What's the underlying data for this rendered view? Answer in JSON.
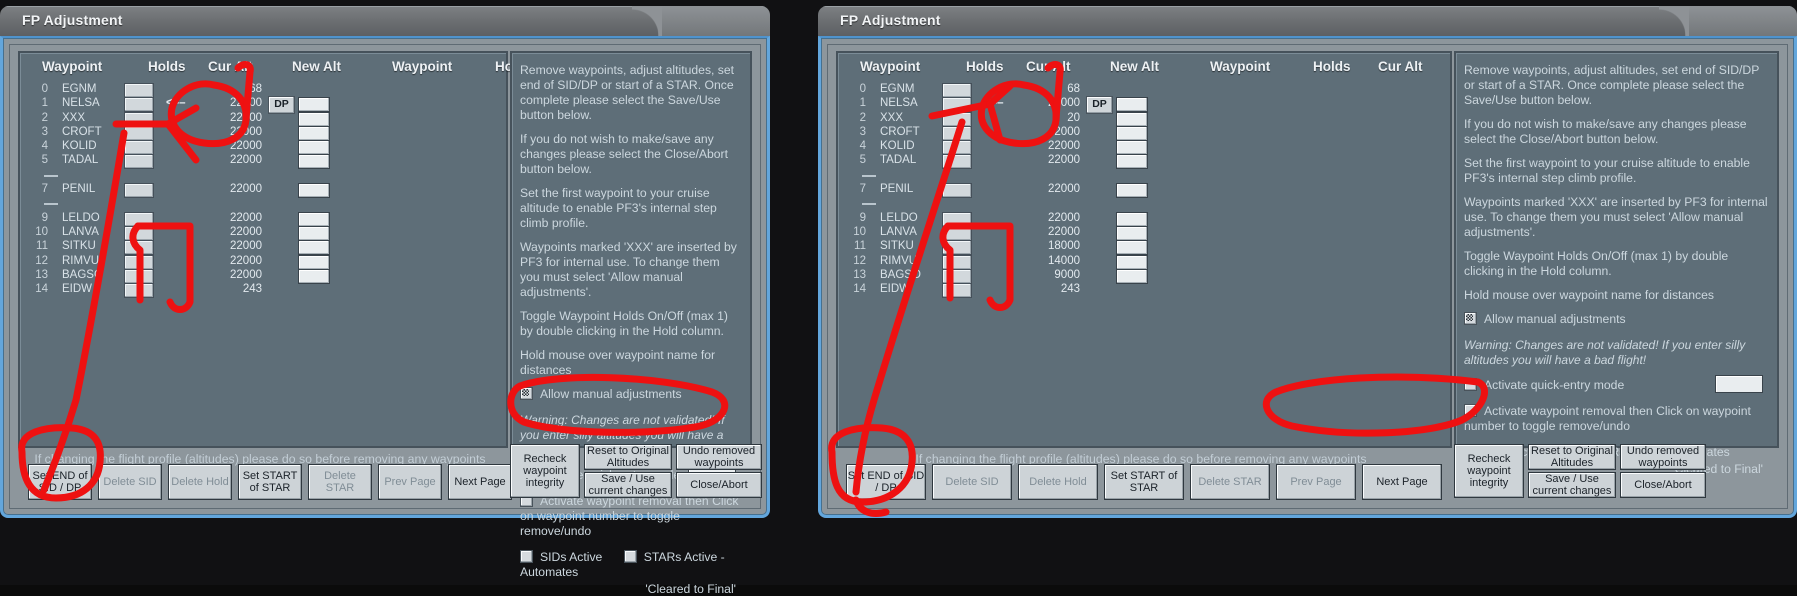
{
  "window": {
    "title": "FP Adjustment"
  },
  "table": {
    "headers": [
      "Waypoint",
      "Holds",
      "Cur Alt",
      "New Alt"
    ],
    "dp_button": "DP",
    "arrow_marker": "<––"
  },
  "left_panel": {
    "rows": [
      {
        "idx": "0",
        "name": "EGNM",
        "alt": "68",
        "sep": false,
        "hold": true,
        "newalt": false
      },
      {
        "idx": "1",
        "name": "NELSA",
        "alt": "22000",
        "sep": false,
        "hold": true,
        "newalt": true,
        "arrow": true,
        "dp": true
      },
      {
        "idx": "2",
        "name": "XXX",
        "alt": "22000",
        "sep": false,
        "hold": true,
        "newalt": true
      },
      {
        "idx": "3",
        "name": "CROFT",
        "alt": "22000",
        "sep": false,
        "hold": true,
        "newalt": true
      },
      {
        "idx": "4",
        "name": "KOLID",
        "alt": "22000",
        "sep": false,
        "hold": true,
        "newalt": true
      },
      {
        "idx": "5",
        "name": "TADAL",
        "alt": "22000",
        "sep": false,
        "hold": true,
        "newalt": true
      },
      {
        "idx": "6",
        "name": "",
        "alt": "",
        "sep": true,
        "hold": false,
        "newalt": false
      },
      {
        "idx": "7",
        "name": "PENIL",
        "alt": "22000",
        "sep": false,
        "hold": true,
        "newalt": true
      },
      {
        "idx": "8",
        "name": "",
        "alt": "",
        "sep": true,
        "hold": false,
        "newalt": false
      },
      {
        "idx": "9",
        "name": "LELDO",
        "alt": "22000",
        "sep": false,
        "hold": true,
        "newalt": true
      },
      {
        "idx": "10",
        "name": "LANVA",
        "alt": "22000",
        "sep": false,
        "hold": true,
        "newalt": true
      },
      {
        "idx": "11",
        "name": "SITKU",
        "alt": "22000",
        "sep": false,
        "hold": true,
        "newalt": true
      },
      {
        "idx": "12",
        "name": "RIMVU",
        "alt": "22000",
        "sep": false,
        "hold": true,
        "newalt": true
      },
      {
        "idx": "13",
        "name": "BAGSO",
        "alt": "22000",
        "sep": false,
        "hold": true,
        "newalt": true
      },
      {
        "idx": "14",
        "name": "EIDW",
        "alt": "243",
        "sep": false,
        "hold": true,
        "newalt": false
      }
    ]
  },
  "right_panel": {
    "rows": [
      {
        "idx": "0",
        "name": "EGNM",
        "alt": "68",
        "sep": false,
        "hold": true,
        "newalt": false
      },
      {
        "idx": "1",
        "name": "NELSA",
        "alt": "22000",
        "sep": false,
        "hold": true,
        "newalt": true,
        "arrow": true,
        "dp": true
      },
      {
        "idx": "2",
        "name": "XXX",
        "alt": "20",
        "sep": false,
        "hold": true,
        "newalt": true
      },
      {
        "idx": "3",
        "name": "CROFT",
        "alt": "2000",
        "sep": false,
        "hold": true,
        "newalt": true
      },
      {
        "idx": "4",
        "name": "KOLID",
        "alt": "22000",
        "sep": false,
        "hold": true,
        "newalt": true
      },
      {
        "idx": "5",
        "name": "TADAL",
        "alt": "22000",
        "sep": false,
        "hold": true,
        "newalt": true
      },
      {
        "idx": "6",
        "name": "",
        "alt": "",
        "sep": true,
        "hold": false,
        "newalt": false
      },
      {
        "idx": "7",
        "name": "PENIL",
        "alt": "22000",
        "sep": false,
        "hold": true,
        "newalt": true
      },
      {
        "idx": "8",
        "name": "",
        "alt": "",
        "sep": true,
        "hold": false,
        "newalt": false
      },
      {
        "idx": "9",
        "name": "LELDO",
        "alt": "22000",
        "sep": false,
        "hold": true,
        "newalt": true
      },
      {
        "idx": "10",
        "name": "LANVA",
        "alt": "22000",
        "sep": false,
        "hold": true,
        "newalt": true
      },
      {
        "idx": "11",
        "name": "SITKU",
        "alt": "18000",
        "sep": false,
        "hold": true,
        "newalt": true
      },
      {
        "idx": "12",
        "name": "RIMVU",
        "alt": "14000",
        "sep": false,
        "hold": true,
        "newalt": true
      },
      {
        "idx": "13",
        "name": "BAGSO",
        "alt": "9000",
        "sep": false,
        "hold": true,
        "newalt": true
      },
      {
        "idx": "14",
        "name": "EIDW",
        "alt": "243",
        "sep": false,
        "hold": true,
        "newalt": false
      }
    ]
  },
  "info": {
    "para1": "Remove waypoints, adjust altitudes, set end of SID/DP or start of a STAR. Once complete please select the Save/Use button below.",
    "para2": "If you do not wish to make/save any changes please select the Close/Abort button below.",
    "para3": "Set the first waypoint to your cruise altitude to enable PF3's internal step climb profile.",
    "para4": "Waypoints marked 'XXX' are inserted by PF3 for internal use. To change them you must select 'Allow manual adjustments'.",
    "para5": "Toggle Waypoint Holds On/Off (max 1) by double clicking in the Hold column.",
    "para6": "Hold mouse over waypoint name for distances",
    "cb_allow_manual": "Allow manual adjustments",
    "warning": "Warning: Changes are not validated! If you enter silly altitudes you will have a bad flight!",
    "cb_quick_entry": "Activate quick-entry mode",
    "cb_waypoint_removal": "Activate waypoint removal then Click on waypoint number to toggle remove/undo",
    "cb_sids_active": "SIDs Active",
    "cb_stars_active": "STARs Active - Automates",
    "cleared_note": "'Cleared to Final'"
  },
  "footer": {
    "note": "If changing the flight profile (altitudes) please do so before removing any waypoints",
    "buttons": [
      {
        "label": "Set END of SID / DP",
        "disabled": false
      },
      {
        "label": "Delete SID",
        "disabled": true
      },
      {
        "label": "Delete Hold",
        "disabled": true
      },
      {
        "label": "Set START of STAR",
        "disabled": false
      },
      {
        "label": "Delete STAR",
        "disabled": true
      },
      {
        "label": "Prev Page",
        "disabled": true
      },
      {
        "label": "Next Page",
        "disabled": false
      }
    ],
    "right_buttons": [
      {
        "label": "Recheck waypoint integrity"
      },
      {
        "label": "Reset to Original Altitudes"
      },
      {
        "label": "Undo removed waypoints"
      },
      {
        "label": "Save / Use current changes"
      },
      {
        "label": "Close/Abort"
      }
    ]
  },
  "annotation": {
    "color": "#ee1111",
    "description": "hand-drawn red ink marks circling the DP button, the Cur Alt column values, the SIDs/STARs Active checkboxes and the Set END of SID / DP button"
  }
}
